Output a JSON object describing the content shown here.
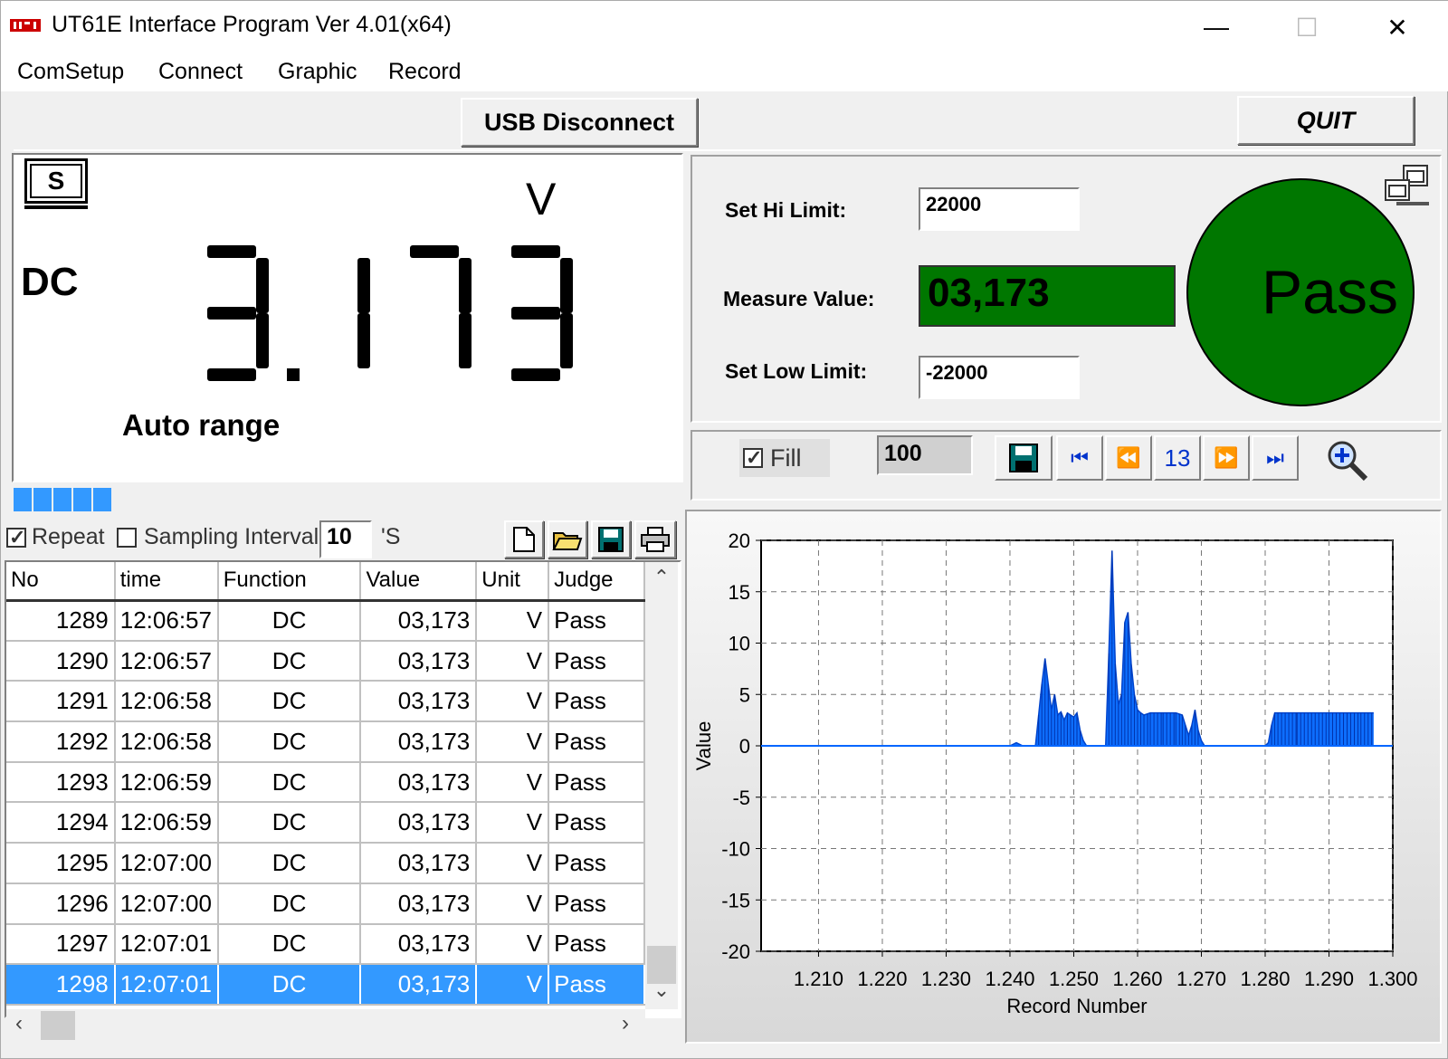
{
  "window": {
    "title": "UT61E Interface Program Ver 4.01(x64)",
    "minimize": "—",
    "maximize": "☐",
    "close": "✕"
  },
  "menu": [
    {
      "label": "ComSetup"
    },
    {
      "label": "Connect"
    },
    {
      "label": "Graphic"
    },
    {
      "label": "Record"
    }
  ],
  "toolbar": {
    "usb_label": "USB Disconnect",
    "quit_label": "QUIT"
  },
  "display": {
    "mode_badge": "S",
    "function": "DC",
    "unit": "V",
    "reading": "3.173",
    "range": "Auto range",
    "bar_segments": 5
  },
  "limits": {
    "hi_label": "Set Hi Limit:",
    "hi_value": "22000",
    "measure_label": "Measure Value:",
    "measure_value": "03,173",
    "low_label": "Set Low Limit:",
    "low_value": "-22000",
    "result": "Pass",
    "result_color": "#007700"
  },
  "graph_controls": {
    "fill_label": "Fill",
    "fill_checked": true,
    "points": "100",
    "page": "13"
  },
  "log": {
    "repeat_label": "Repeat",
    "repeat_checked": true,
    "interval_label": "Sampling Interval",
    "interval_checked": false,
    "interval_value": "10",
    "interval_unit": "'S",
    "columns": [
      "No",
      "time",
      "Function",
      "Value",
      "Unit",
      "Judge"
    ],
    "rows": [
      [
        "1289",
        "12:06:57",
        "DC",
        "03,173",
        "V",
        "Pass"
      ],
      [
        "1290",
        "12:06:57",
        "DC",
        "03,173",
        "V",
        "Pass"
      ],
      [
        "1291",
        "12:06:58",
        "DC",
        "03,173",
        "V",
        "Pass"
      ],
      [
        "1292",
        "12:06:58",
        "DC",
        "03,173",
        "V",
        "Pass"
      ],
      [
        "1293",
        "12:06:59",
        "DC",
        "03,173",
        "V",
        "Pass"
      ],
      [
        "1294",
        "12:06:59",
        "DC",
        "03,173",
        "V",
        "Pass"
      ],
      [
        "1295",
        "12:07:00",
        "DC",
        "03,173",
        "V",
        "Pass"
      ],
      [
        "1296",
        "12:07:00",
        "DC",
        "03,173",
        "V",
        "Pass"
      ],
      [
        "1297",
        "12:07:01",
        "DC",
        "03,173",
        "V",
        "Pass"
      ],
      [
        "1298",
        "12:07:01",
        "DC",
        "03,173",
        "V",
        "Pass"
      ]
    ],
    "selected_row": 9
  },
  "chart_data": {
    "type": "area",
    "xlabel": "Record Number",
    "ylabel": "Value",
    "xlim": [
      1.201,
      1.3
    ],
    "ylim": [
      -20,
      20
    ],
    "xticks": [
      "1.210",
      "1.220",
      "1.230",
      "1.240",
      "1.250",
      "1.260",
      "1.270",
      "1.280",
      "1.290",
      "1.300"
    ],
    "xtick_values": [
      1.21,
      1.22,
      1.23,
      1.24,
      1.25,
      1.26,
      1.27,
      1.28,
      1.29,
      1.3
    ],
    "yticks": [
      20,
      15,
      10,
      5,
      0,
      -5,
      -10,
      -15,
      -20
    ],
    "grid": true,
    "series_color": "#0066ff",
    "x": [
      1.201,
      1.24,
      1.241,
      1.242,
      1.244,
      1.2445,
      1.245,
      1.2455,
      1.246,
      1.2465,
      1.247,
      1.2475,
      1.248,
      1.2485,
      1.249,
      1.2495,
      1.25,
      1.2505,
      1.251,
      1.2515,
      1.252,
      1.253,
      1.254,
      1.255,
      1.2555,
      1.256,
      1.2565,
      1.257,
      1.2575,
      1.258,
      1.2585,
      1.259,
      1.2595,
      1.26,
      1.2605,
      1.261,
      1.262,
      1.264,
      1.266,
      1.267,
      1.2675,
      1.268,
      1.2685,
      1.269,
      1.2695,
      1.27,
      1.2705,
      1.271,
      1.272,
      1.279,
      1.28,
      1.2805,
      1.281,
      1.2815,
      1.282,
      1.285,
      1.29,
      1.295,
      1.297
    ],
    "y": [
      0,
      0,
      0.3,
      0,
      0,
      3.0,
      6.0,
      8.5,
      6.0,
      3.5,
      5.0,
      3.0,
      3.3,
      2.5,
      3.2,
      3.0,
      2.8,
      3.2,
      1.5,
      0.5,
      0,
      0,
      0,
      0,
      9.0,
      19.0,
      8.0,
      4.0,
      5.0,
      12.0,
      13.0,
      8.0,
      5.0,
      3.5,
      3.2,
      3.0,
      3.2,
      3.2,
      3.2,
      3.0,
      2.0,
      1.0,
      2.0,
      3.5,
      1.5,
      0.5,
      0,
      0,
      0,
      0,
      0,
      0.3,
      2.0,
      3.2,
      3.2,
      3.2,
      3.2,
      3.2,
      3.2
    ]
  }
}
